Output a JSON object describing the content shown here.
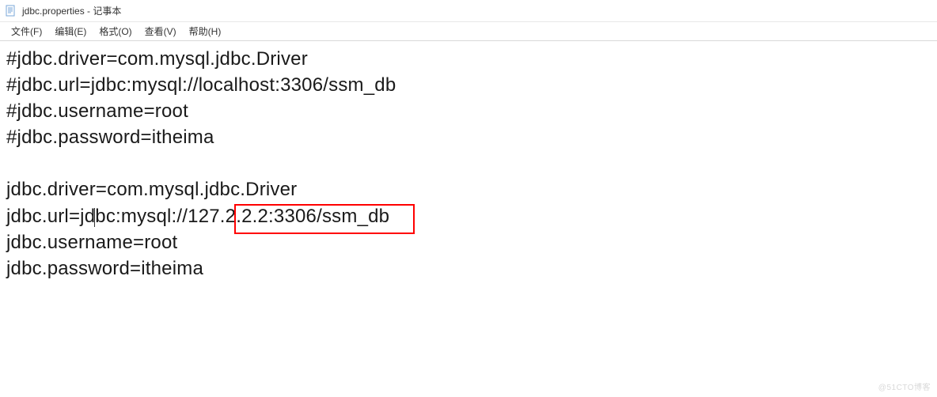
{
  "window": {
    "filename": "jdbc.properties",
    "app_name": "记事本",
    "title_separator": " - "
  },
  "menu": {
    "file": "文件(F)",
    "edit": "编辑(E)",
    "format": "格式(O)",
    "view": "查看(V)",
    "help": "帮助(H)"
  },
  "content": {
    "lines": [
      "#jdbc.driver=com.mysql.jdbc.Driver",
      "#jdbc.url=jdbc:mysql://localhost:3306/ssm_db",
      "#jdbc.username=root",
      "#jdbc.password=itheima",
      "",
      "jdbc.driver=com.mysql.jdbc.Driver",
      "jdbc.url=jdbc:mysql://127.2.2.2:3306/ssm_db",
      "jdbc.username=root",
      "jdbc.password=itheima"
    ],
    "line7_part1": "jdbc.url=jd",
    "line7_part2": "bc:mysql://127.2.2.2:3306/ssm_db"
  },
  "highlight": {
    "text": "127.2.2.2:3306"
  },
  "watermark": "@51CTO博客"
}
